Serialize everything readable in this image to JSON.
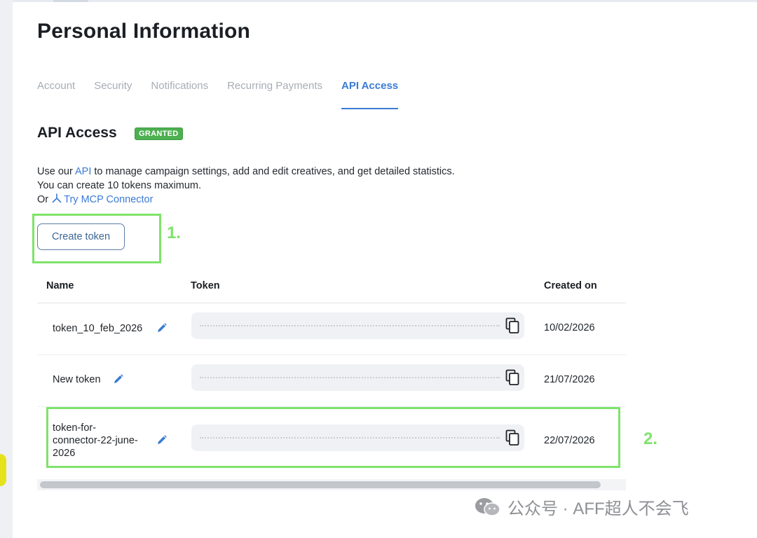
{
  "page": {
    "title": "Personal Information"
  },
  "tabs": [
    {
      "label": "Account"
    },
    {
      "label": "Security"
    },
    {
      "label": "Notifications"
    },
    {
      "label": "Recurring Payments"
    },
    {
      "label": "API Access",
      "active": true
    }
  ],
  "section": {
    "title": "API Access",
    "badge": "GRANTED"
  },
  "description": {
    "line1_prefix": "Use our ",
    "line1_link": "API",
    "line1_suffix": " to manage campaign settings, add and edit creatives, and get detailed statistics.",
    "line2": "You can create 10 tokens maximum.",
    "line3_prefix": "Or ",
    "line3_link": "Try MCP Connector"
  },
  "create_button": "Create token",
  "table": {
    "columns": [
      "Name",
      "Token",
      "Created on"
    ],
    "rows": [
      {
        "name": "token_10_feb_2026",
        "created": "10/02/2026"
      },
      {
        "name": "New token",
        "created": "21/07/2026"
      },
      {
        "name": "token-for-connector-22-june-2026",
        "name_lines": [
          "token-for-",
          "connector-22-june-",
          "2026"
        ],
        "created": "22/07/2026"
      }
    ]
  },
  "annotations": {
    "label1": "1.",
    "label2": "2."
  },
  "watermark": {
    "text": "公众号 · AFF超人不会飞"
  },
  "colors": {
    "accent": "#3a7bd5",
    "badge": "#4caf50",
    "highlight": "#7fe36a"
  }
}
